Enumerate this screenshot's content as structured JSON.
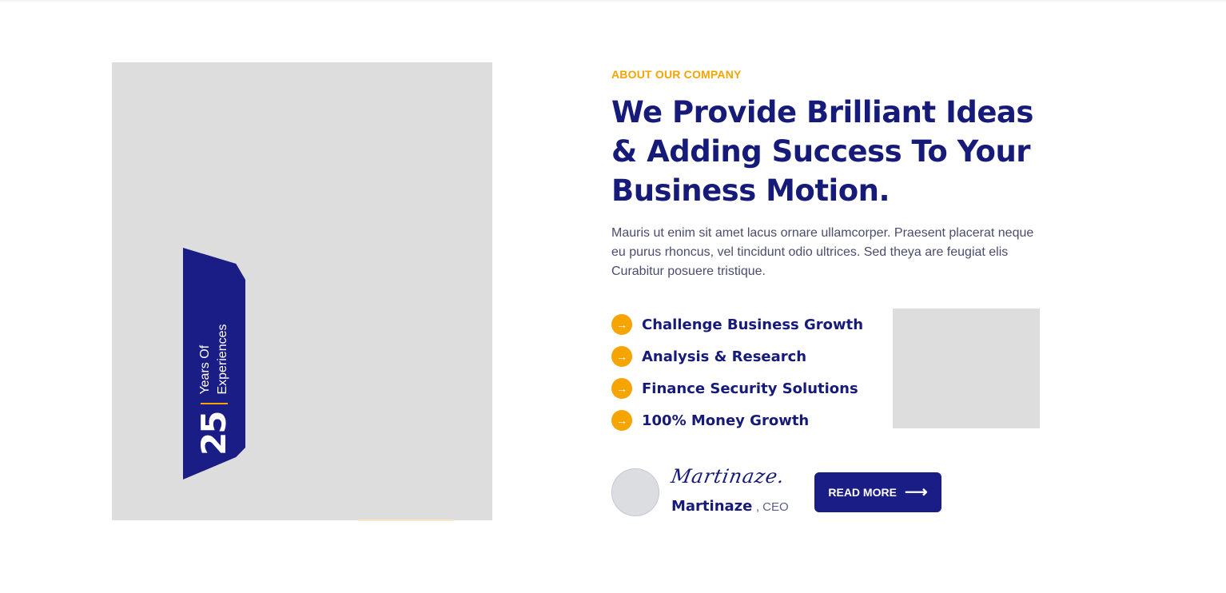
{
  "about": {
    "eyebrow": "ABOUT OUR COMPANY",
    "headline": "We Provide Brilliant Ideas & Adding Success To Your Business Motion.",
    "paragraph": "Mauris ut enim sit amet lacus ornare ullamcorper. Praesent placerat neque eu purus rhoncus, vel tincidunt odio ultrices. Sed theya are feugiat elis Curabitur posuere tristique.",
    "features": [
      {
        "label": "Challenge Business Growth",
        "icon": "arrow-right-icon"
      },
      {
        "label": "Analysis & Research",
        "icon": "arrow-right-icon"
      },
      {
        "label": "Finance Security Solutions",
        "icon": "arrow-right-icon"
      },
      {
        "label": "100% Money Growth",
        "icon": "arrow-right-icon"
      }
    ],
    "author": {
      "signature": "Martinaze.",
      "name": "Martinaze",
      "role": ", CEO"
    },
    "read_more_label": "READ MORE"
  },
  "experience": {
    "number": "25",
    "line1": "Years Of",
    "line2": "Experiences"
  },
  "colors": {
    "primary": "#161a78",
    "accent": "#f5a400",
    "placeholder": "#dddddd"
  }
}
